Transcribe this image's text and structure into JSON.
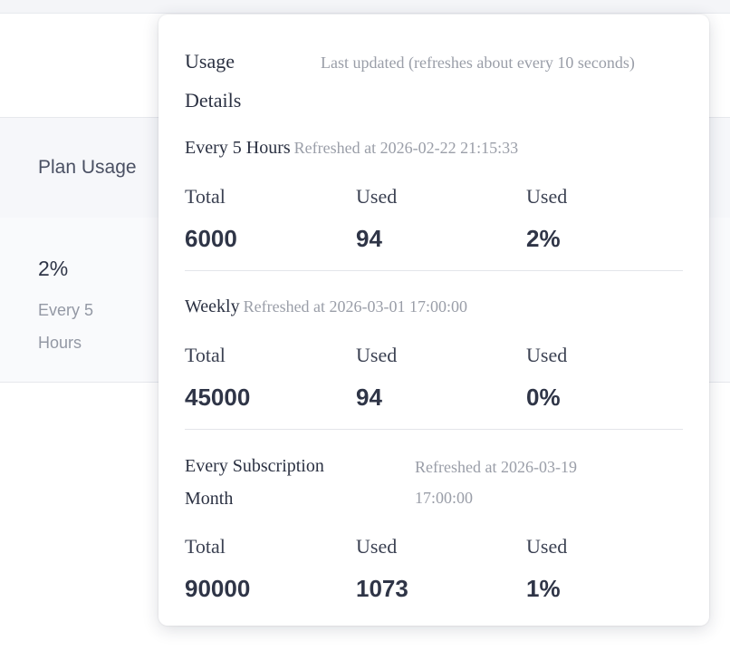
{
  "background": {
    "table_header": "Plan Usage",
    "row": {
      "percent": "2%",
      "caption": "Every 5 Hours"
    }
  },
  "popover": {
    "title": "Usage Details",
    "subtitle": "Last updated (refreshes about every 10 seconds)",
    "sections": [
      {
        "name": "Every 5 Hours",
        "refreshed": "Refreshed at 2026-02-22 21:15:33",
        "stats": [
          {
            "label": "Total",
            "value": "6000"
          },
          {
            "label": "Used",
            "value": "94"
          },
          {
            "label": "Used",
            "value": "2%"
          }
        ]
      },
      {
        "name": "Weekly",
        "refreshed": "Refreshed at 2026-03-01 17:00:00",
        "stats": [
          {
            "label": "Total",
            "value": "45000"
          },
          {
            "label": "Used",
            "value": "94"
          },
          {
            "label": "Used",
            "value": "0%"
          }
        ]
      },
      {
        "name": "Every Subscription Month",
        "refreshed": "Refreshed at 2026-03-19 17:00:00",
        "stats": [
          {
            "label": "Total",
            "value": "90000"
          },
          {
            "label": "Used",
            "value": "1073"
          },
          {
            "label": "Used",
            "value": "1%"
          }
        ]
      }
    ]
  }
}
